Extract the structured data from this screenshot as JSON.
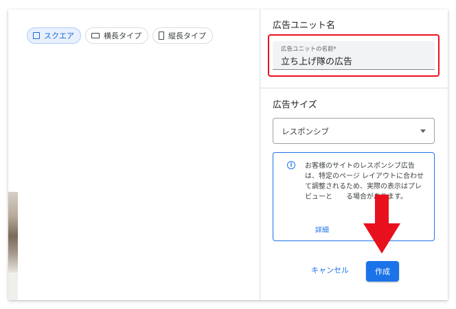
{
  "format_chips": [
    {
      "label": "スクエア",
      "icon": "square-icon",
      "selected": true
    },
    {
      "label": "横長タイプ",
      "icon": "landscape-icon",
      "selected": false
    },
    {
      "label": "縦長タイプ",
      "icon": "portrait-icon",
      "selected": false
    }
  ],
  "panel": {
    "name_section_title": "広告ユニット名",
    "name_field_label": "広告ユニットの名前*",
    "name_field_value": "立ち上げ隊の広告",
    "size_section_title": "広告サイズ",
    "size_select_value": "レスポンシブ",
    "info_text": "お客様のサイトのレスポンシブ広告は、特定のページ レイアウトに合わせて調整されるため、実際の表示はプレビューと　　る場合があります。",
    "info_link": "詳細",
    "cancel_label": "キャンセル",
    "create_label": "作成"
  },
  "colors": {
    "accent": "#1a73e8",
    "highlight_red": "#e8101d"
  }
}
